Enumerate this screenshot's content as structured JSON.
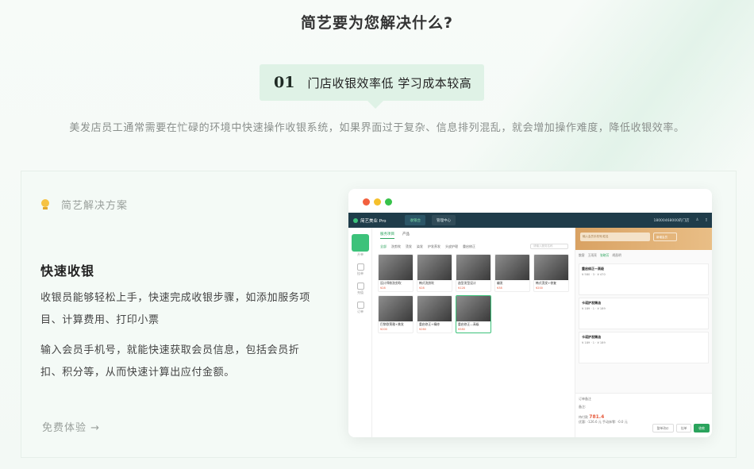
{
  "header": {
    "title": "简艺要为您解决什么?"
  },
  "problem": {
    "number": "01",
    "title": "门店收银效率低 学习成本较高",
    "description": "美发店员工通常需要在忙碌的环境中快速操作收银系统，如果界面过于复杂、信息排列混乱，就会增加操作难度，降低收银效率。"
  },
  "solution": {
    "label": "简艺解决方案",
    "feature_title": "快速收银",
    "paragraph_1": "收银员能够轻松上手，快速完成收银步骤，如添加服务项目、计算费用、打印小票",
    "paragraph_2": "输入会员手机号，就能快速获取会员信息，包括会员折扣、积分等，从而快速计算出应付金额。",
    "cta": "免费体验 →"
  },
  "mock_app": {
    "brand": "简艺美业 Pro",
    "top_tabs": [
      "收银台",
      "管理中心"
    ],
    "store": "18000468000的门店",
    "left_nav": [
      "开单",
      "挂单",
      "充值",
      "订单"
    ],
    "sub_tabs": [
      "服务项目",
      "产品"
    ],
    "categories": [
      "全部",
      "洗剪吹",
      "烫发",
      "染发",
      "护发养发",
      "头皮护理",
      "重启修正"
    ],
    "search_placeholder": "请输入服务名称",
    "cards": [
      {
        "name": "设计师款洗剪吹",
        "price": "¥28"
      },
      {
        "name": "韩式洗剪吹",
        "price": "¥28"
      },
      {
        "name": "造型发型设计",
        "price": "¥128"
      },
      {
        "name": "编发",
        "price": "¥38"
      },
      {
        "name": "韩式烫发+修复",
        "price": "¥200"
      },
      {
        "name": "巴黎欧莱雅+美发",
        "price": "¥200"
      },
      {
        "name": "重启修正+精修",
        "price": "¥260"
      },
      {
        "name": "重启修正—高级",
        "price": "¥580"
      }
    ],
    "member_placeholder": "输入会员手机号/姓名",
    "member_button": "新增会员",
    "staff_tabs": [
      "散客",
      "王雨亮",
      "张晓芳",
      "胡昌明"
    ],
    "services": [
      {
        "name": "重启修正—高级",
        "price": "¥ 580",
        "qty": "3",
        "subtotal": "¥ 470"
      },
      {
        "name": "卡诺护发精油",
        "price": "¥ 189",
        "qty": "1",
        "subtotal": "¥ 189"
      },
      {
        "name": "卡诺护发精油",
        "price": "¥ 189",
        "qty": "1",
        "subtotal": "¥ 189"
      }
    ],
    "order_remark": "订单备注",
    "remark_label": "备注:",
    "total_label": "待付款",
    "total_value": "781.4",
    "discount_line": "优惠: -126.6 元    手动抹零: -0.0 元",
    "buttons": [
      "整单改价",
      "挂单",
      "收款"
    ]
  },
  "colors": {
    "accent_green": "#2aa35c",
    "tag_bg": "#dff2e6",
    "topbar": "#1f3c4a",
    "price_red": "#e65a3c"
  }
}
